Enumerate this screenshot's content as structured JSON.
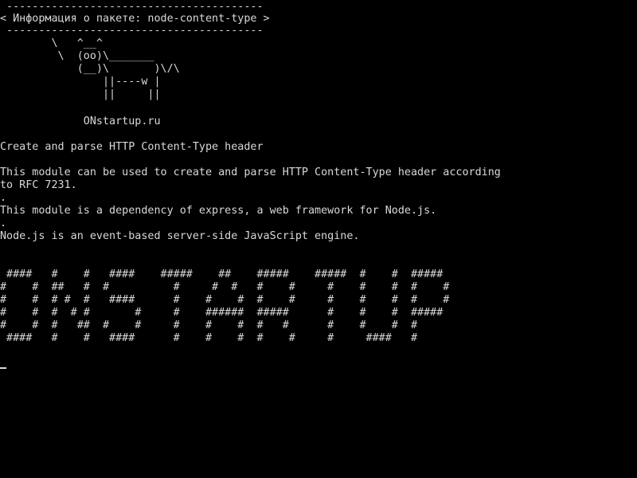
{
  "terminal": {
    "colors": {
      "background": "#000000",
      "foreground": "#d9d9d9"
    },
    "cowsay": {
      "border_top": " ----------------------------------------",
      "message": "< Информация о пакете: node-content-type >",
      "border_bottom": " ----------------------------------------",
      "cow": [
        "        \\   ^__^",
        "         \\  (oo)\\_______",
        "            (__)\\       )\\/\\",
        "                ||----w |",
        "                ||     ||"
      ]
    },
    "site": "             ONstartup.ru",
    "summary": "Create and parse HTTP Content-Type header",
    "description": [
      "This module can be used to create and parse HTTP Content-Type header according",
      "to RFC 7231.",
      ".",
      "This module is a dependency of express, a web framework for Node.js.",
      ".",
      "Node.js is an event-based server-side JavaScript engine."
    ],
    "banner": [
      " ####   #    #   ####    #####    ##    #####    #####  #    #  #####",
      "#    #  ##   #  #          #     #  #   #    #     #    #    #  #    #",
      "#    #  # #  #   ####      #    #    #  #    #     #    #    #  #    #",
      "#    #  #  # #       #     #    ######  #####      #    #    #  #####",
      "#    #  #   ##  #    #     #    #    #  #   #      #    #    #  #",
      " ####   #    #   ####      #    #    #  #    #     #     ####   #"
    ],
    "cursor": "_"
  }
}
